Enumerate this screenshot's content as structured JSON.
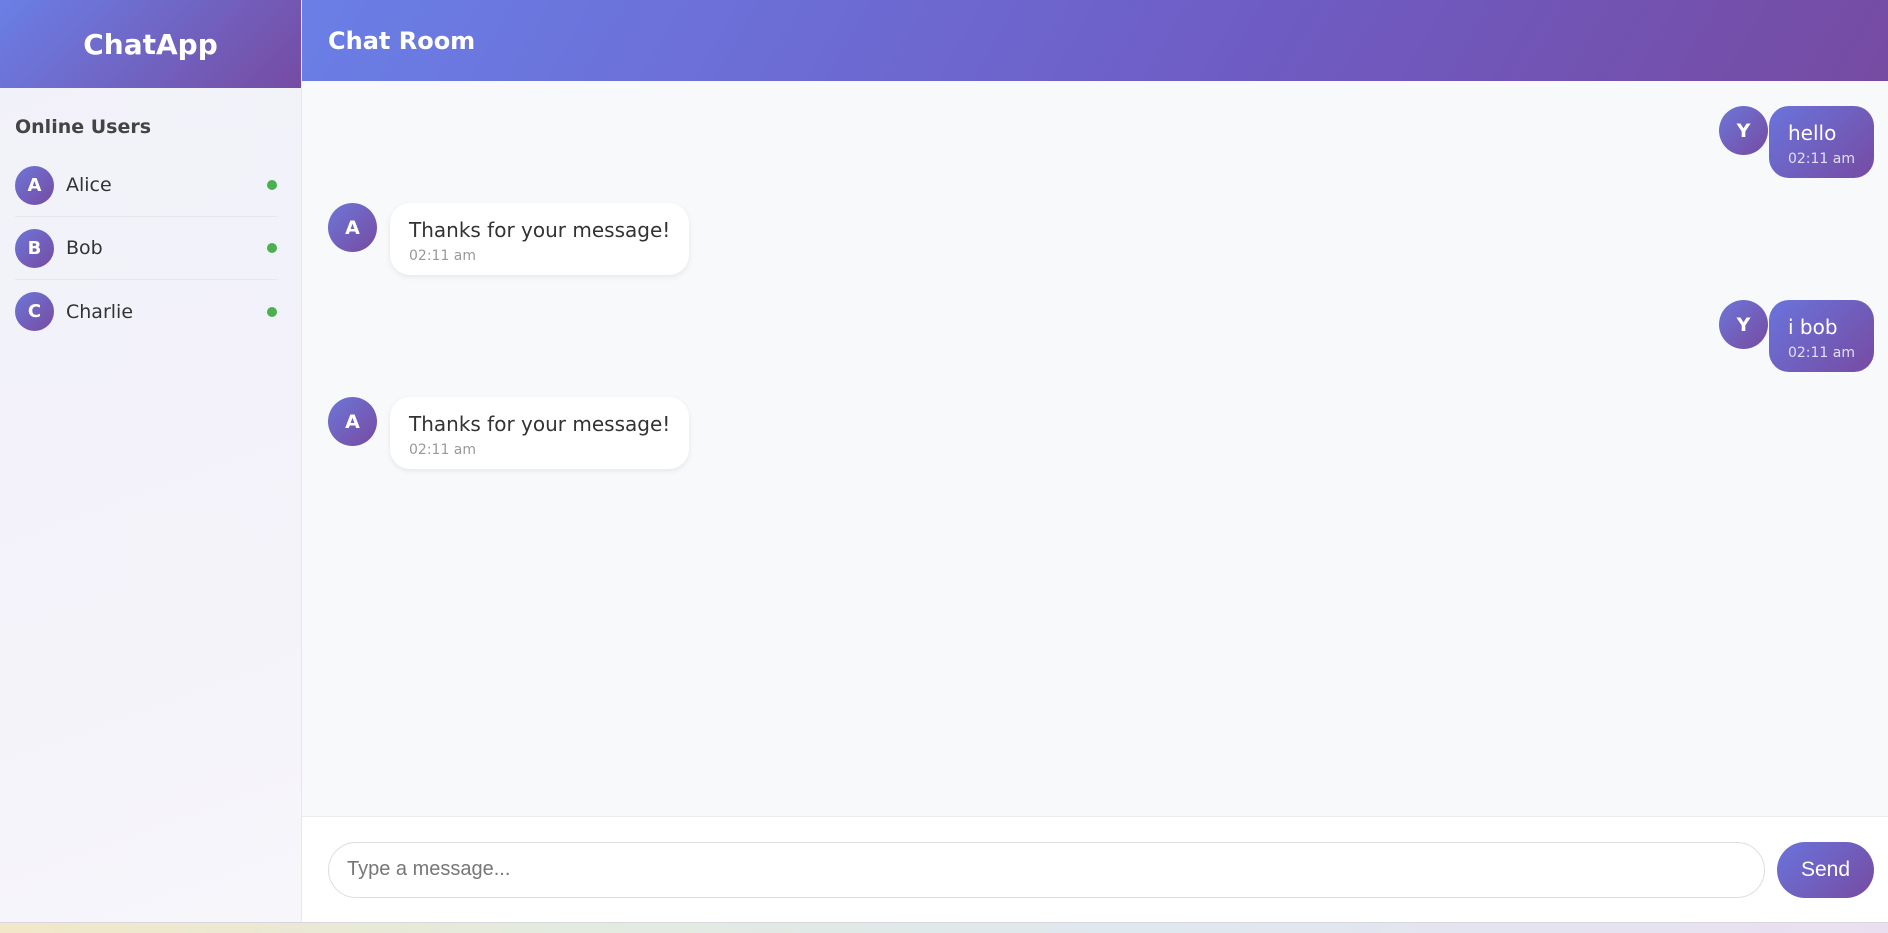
{
  "sidebar": {
    "app_title": "ChatApp",
    "online_title": "Online Users",
    "users": [
      {
        "initial": "A",
        "name": "Alice",
        "status": "online"
      },
      {
        "initial": "B",
        "name": "Bob",
        "status": "online"
      },
      {
        "initial": "C",
        "name": "Charlie",
        "status": "online"
      }
    ]
  },
  "header": {
    "title": "Chat Room"
  },
  "messages": [
    {
      "direction": "outgoing",
      "initial": "Y",
      "text": "hello",
      "time": "02:11 am"
    },
    {
      "direction": "incoming",
      "initial": "A",
      "text": "Thanks for your message!",
      "time": "02:11 am"
    },
    {
      "direction": "outgoing",
      "initial": "Y",
      "text": "i bob",
      "time": "02:11 am"
    },
    {
      "direction": "incoming",
      "initial": "A",
      "text": "Thanks for your message!",
      "time": "02:11 am"
    }
  ],
  "composer": {
    "placeholder": "Type a message...",
    "value": "",
    "send_label": "Send"
  },
  "colors": {
    "accent_start": "#667eea",
    "accent_end": "#764ba2",
    "online_status": "#4caf50"
  }
}
